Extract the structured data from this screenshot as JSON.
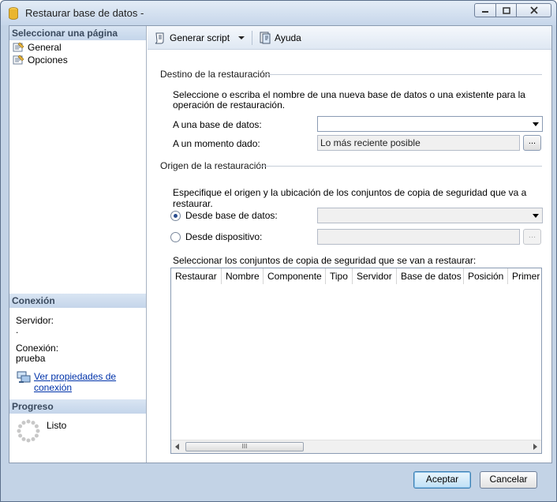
{
  "window": {
    "title": "Restaurar base de datos -",
    "icons": {
      "app": "database-icon",
      "minimize": "minimize-icon",
      "maximize": "maximize-icon",
      "close": "close-icon"
    }
  },
  "left": {
    "select_page_header": "Seleccionar una página",
    "pages": [
      {
        "label": "General",
        "icon": "page-icon"
      },
      {
        "label": "Opciones",
        "icon": "page-icon"
      }
    ],
    "connection_header": "Conexión",
    "server_label": "Servidor:",
    "server_value": ".",
    "connection_label": "Conexión:",
    "connection_value": "prueba",
    "properties_link": "Ver propiedades de conexión",
    "progress_header": "Progreso",
    "progress_status": "Listo"
  },
  "toolbar": {
    "script_label": "Generar script",
    "help_label": "Ayuda"
  },
  "destination": {
    "title": "Destino de la restauración",
    "description": "Seleccione o escriba el nombre de una nueva base de datos o una existente para la operación de restauración.",
    "to_database_label": "A una base de datos:",
    "to_database_value": "",
    "point_in_time_label": "A un momento dado:",
    "point_in_time_value": "Lo más reciente posible",
    "ellipsis": "..."
  },
  "source": {
    "title": "Origen de la restauración",
    "description": "Especifique el origen y la ubicación de los conjuntos de copia de seguridad que va a restaurar.",
    "from_database_label": "Desde base de datos:",
    "from_database_value": "",
    "from_device_label": "Desde dispositivo:",
    "from_device_value": "",
    "ellipsis": "...",
    "selected_option": "from_database"
  },
  "backup_sets": {
    "label": "Seleccionar los conjuntos de copia de seguridad que se van a restaurar:",
    "columns": [
      "Restaurar",
      "Nombre",
      "Componente",
      "Tipo",
      "Servidor",
      "Base de datos",
      "Posición",
      "Primer L"
    ],
    "rows": [],
    "scroll_thumb_grip": "III"
  },
  "footer": {
    "ok_label": "Aceptar",
    "cancel_label": "Cancelar"
  }
}
